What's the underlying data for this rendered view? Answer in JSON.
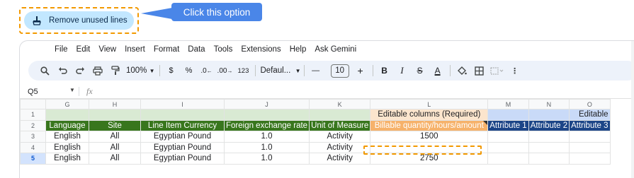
{
  "callout": {
    "button_label": "Remove unused lines",
    "tip_text": "Click this option"
  },
  "menu": [
    "File",
    "Edit",
    "View",
    "Insert",
    "Format",
    "Data",
    "Tools",
    "Extensions",
    "Help",
    "Ask Gemini"
  ],
  "toolbar": {
    "zoom": "100%",
    "currency": "$",
    "percent": "%",
    "decrease_decimal": ".0",
    "increase_decimal": ".00",
    "number_format": "123",
    "font": "Defaul...",
    "font_size": "10",
    "minus": "—",
    "plus": "+",
    "bold": "B",
    "italic": "I",
    "strike": "S",
    "text_color": "A"
  },
  "formula_bar": {
    "name_box": "Q5",
    "fx": "fx"
  },
  "columns": [
    "G",
    "H",
    "I",
    "J",
    "K",
    "L",
    "M",
    "N",
    "O"
  ],
  "rows": {
    "row1": {
      "num": "1",
      "editable_required": "Editable columns (Required)",
      "editable_other": "Editable"
    },
    "row2": {
      "num": "2",
      "headers": [
        "Language",
        "Site",
        "Line Item Currency",
        "Foreign exchange rate",
        "Unit of Measure",
        "Billable quantity/hours/amount",
        "Attribute 1",
        "Attribute 2",
        "Attribute 3"
      ]
    },
    "data": [
      {
        "num": "3",
        "cells": [
          "English",
          "All",
          "Egyptian Pound",
          "1.0",
          "Activity",
          "1500",
          "",
          "",
          ""
        ]
      },
      {
        "num": "4",
        "cells": [
          "English",
          "All",
          "Egyptian Pound",
          "1.0",
          "Activity",
          "",
          "",
          "",
          ""
        ]
      },
      {
        "num": "5",
        "cells": [
          "English",
          "All",
          "Egyptian Pound",
          "1.0",
          "Activity",
          "2750",
          "",
          "",
          ""
        ]
      }
    ]
  },
  "colors": {
    "callout_button": "#c2e7ff",
    "tip": "#4a86e8",
    "dashed": "#f29900",
    "header_green": "#38761d",
    "header_orange": "#f6b26b",
    "header_navy": "#1c4587"
  }
}
